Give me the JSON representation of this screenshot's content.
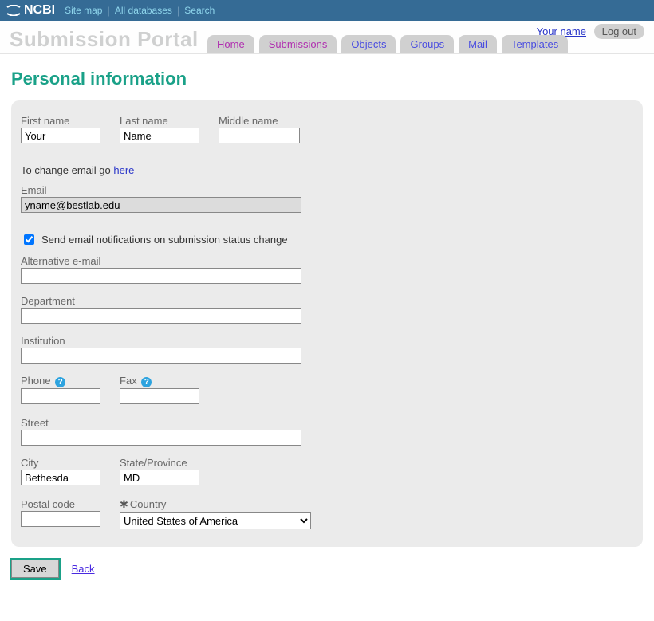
{
  "topnav": {
    "brand": "NCBI",
    "links": {
      "sitemap": "Site map",
      "alldb": "All databases",
      "search": "Search"
    }
  },
  "portal_title": "Submission Portal",
  "user": {
    "name_link": "Your name",
    "logout": "Log out"
  },
  "tabs": [
    {
      "key": "home",
      "label": "Home"
    },
    {
      "key": "submissions",
      "label": "Submissions"
    },
    {
      "key": "objects",
      "label": "Objects"
    },
    {
      "key": "groups",
      "label": "Groups"
    },
    {
      "key": "mail",
      "label": "Mail"
    },
    {
      "key": "templates",
      "label": "Templates"
    }
  ],
  "page_heading": "Personal information",
  "form": {
    "first_name": {
      "label": "First name",
      "value": "Your"
    },
    "last_name": {
      "label": "Last name",
      "value": "Name"
    },
    "middle_name": {
      "label": "Middle name",
      "value": ""
    },
    "change_email_prefix": "To change email go ",
    "change_email_link": "here",
    "email": {
      "label": "Email",
      "value": "yname@bestlab.edu"
    },
    "notify_label": "Send email notifications on submission status change",
    "notify_checked": true,
    "alt_email": {
      "label": "Alternative e-mail",
      "value": ""
    },
    "department": {
      "label": "Department",
      "value": ""
    },
    "institution": {
      "label": "Institution",
      "value": ""
    },
    "phone": {
      "label": "Phone",
      "value": ""
    },
    "fax": {
      "label": "Fax",
      "value": ""
    },
    "street": {
      "label": "Street",
      "value": ""
    },
    "city": {
      "label": "City",
      "value": "Bethesda"
    },
    "state": {
      "label": "State/Province",
      "value": "MD"
    },
    "postal": {
      "label": "Postal code",
      "value": ""
    },
    "country": {
      "label": "Country",
      "selected": "United States of America"
    }
  },
  "actions": {
    "save": "Save",
    "back": "Back"
  }
}
